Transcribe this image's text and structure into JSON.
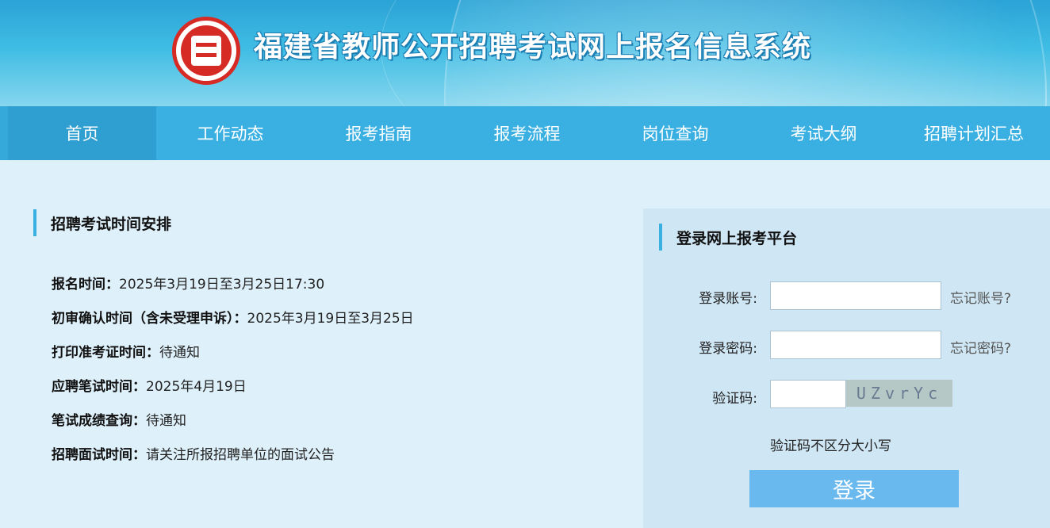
{
  "header": {
    "title": "福建省教师公开招聘考试网上报名信息系统"
  },
  "nav": {
    "items": [
      "首页",
      "工作动态",
      "报考指南",
      "报考流程",
      "岗位查询",
      "考试大纲",
      "招聘计划汇总"
    ],
    "active_index": 0
  },
  "schedule": {
    "title": "招聘考试时间安排",
    "rows": [
      {
        "label": "报名时间：",
        "value": "2025年3月19日至3月25日17:30"
      },
      {
        "label": "初审确认时间（含未受理申诉）：",
        "value": "2025年3月19日至3月25日"
      },
      {
        "label": "打印准考证时间：",
        "value": "待通知"
      },
      {
        "label": "应聘笔试时间：",
        "value": "2025年4月19日"
      },
      {
        "label": "笔试成绩查询：",
        "value": "待通知"
      },
      {
        "label": "招聘面试时间：",
        "value": "请关注所报招聘单位的面试公告"
      }
    ]
  },
  "login": {
    "title": "登录网上报考平台",
    "account_label": "登录账号:",
    "account_value": "",
    "forgot_account": "忘记账号?",
    "password_label": "登录密码:",
    "password_value": "",
    "forgot_password": "忘记密码?",
    "captcha_label": "验证码:",
    "captcha_value": "",
    "captcha_text": "UZvrYc",
    "captcha_note": "验证码不区分大小写",
    "submit_label": "登录"
  },
  "colors": {
    "nav_bg": "#3ab0e2",
    "nav_active_bg": "#2e9fd0",
    "page_bg": "#def0fa",
    "login_panel_bg": "#cfe6f4",
    "login_button_bg": "#6ab9ee",
    "logo_red": "#d62b25"
  },
  "icons": {
    "logo": "emblem-logo"
  }
}
